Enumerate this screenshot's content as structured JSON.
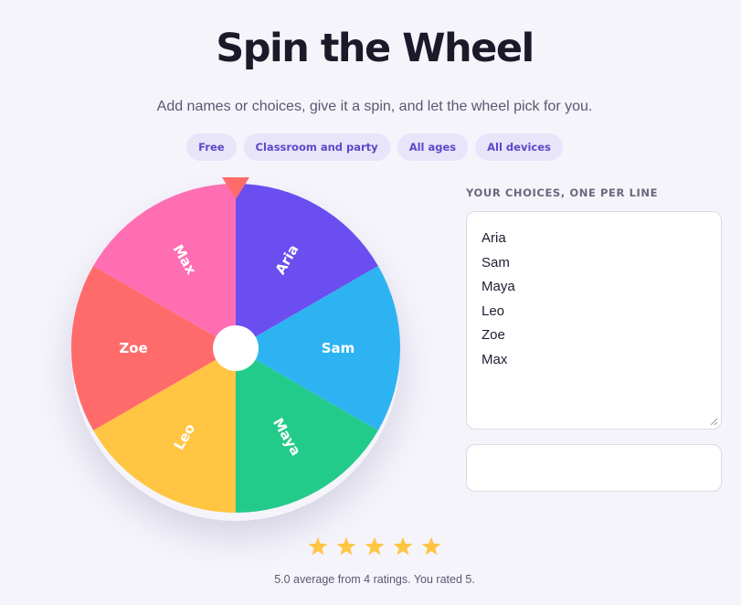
{
  "header": {
    "title": "Spin the Wheel",
    "subtitle": "Add names or choices, give it a spin, and let the wheel pick for you."
  },
  "tags": [
    "Free",
    "Classroom and party",
    "All ages",
    "All devices"
  ],
  "wheel": {
    "segments": [
      {
        "label": "Aria",
        "color": "#6b4ef0"
      },
      {
        "label": "Sam",
        "color": "#2eb3f2"
      },
      {
        "label": "Maya",
        "color": "#23cb8b"
      },
      {
        "label": "Leo",
        "color": "#ffc543"
      },
      {
        "label": "Zoe",
        "color": "#ff6b6b"
      },
      {
        "label": "Max",
        "color": "#ff6eb2"
      }
    ],
    "pointer_color": "#ff6b6b",
    "hub_color": "#ffffff"
  },
  "choices": {
    "label": "YOUR CHOICES, ONE PER LINE",
    "lines": [
      "Aria",
      "Sam",
      "Maya",
      "Leo",
      "Zoe",
      "Max"
    ]
  },
  "extra_input": {
    "value": ""
  },
  "rating": {
    "stars_total": 5,
    "stars_filled": 5,
    "star_color": "#ffc543",
    "summary": "5.0 average from 4 ratings. You rated 5."
  }
}
